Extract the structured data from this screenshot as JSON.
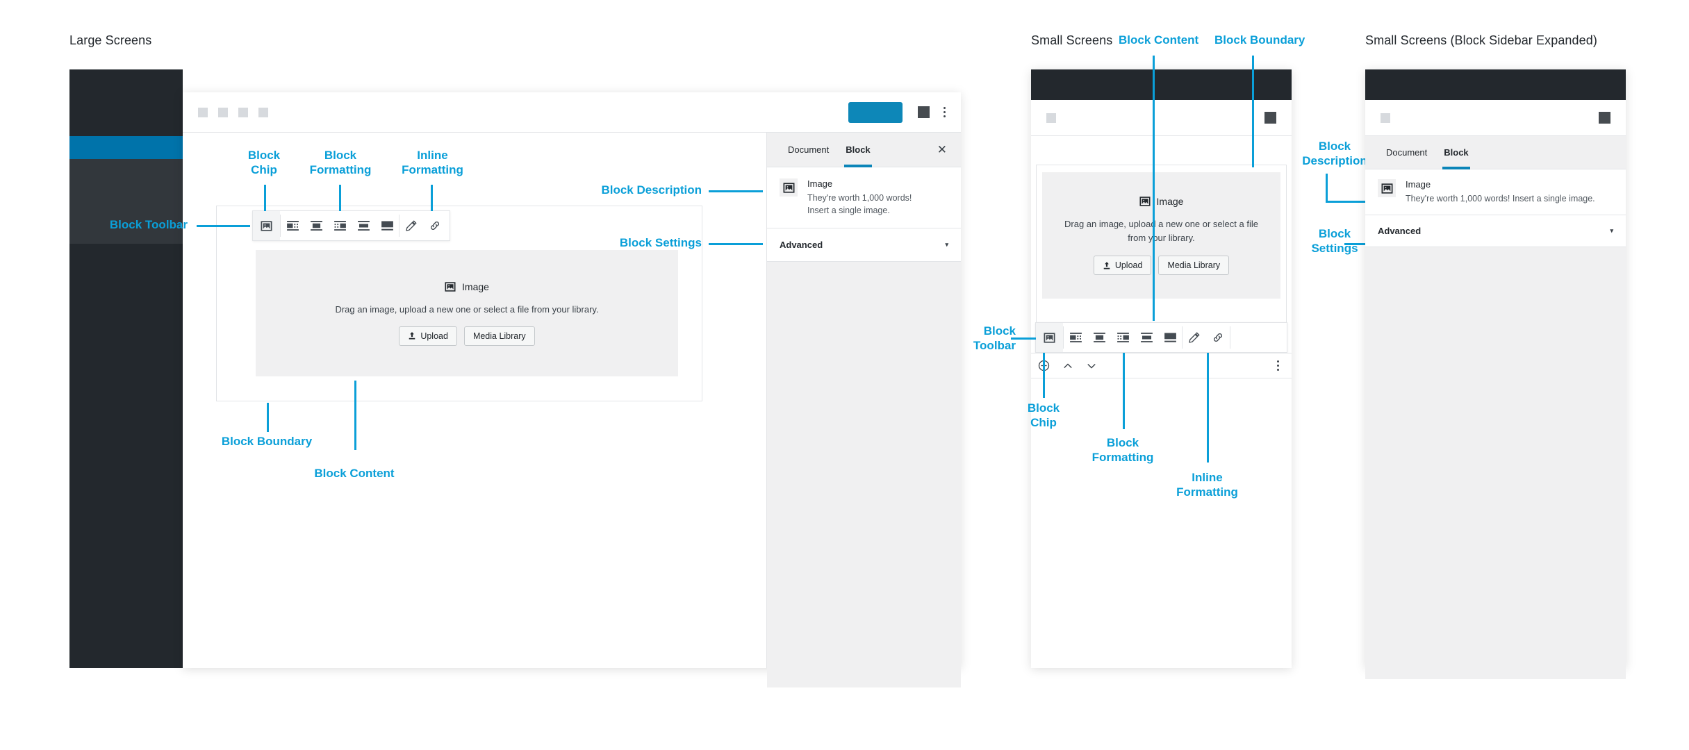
{
  "sections": {
    "large": "Large Screens",
    "small": "Small Screens",
    "small_expanded": "Small Screens (Block Sidebar Expanded)"
  },
  "annotations": {
    "block_toolbar": "Block\nToolbar",
    "block_toolbar_inline": "Block Toolbar",
    "block_chip": "Block\nChip",
    "block_formatting": "Block\nFormatting",
    "inline_formatting": "Inline\nFormatting",
    "block_description": "Block Description",
    "block_description_stacked": "Block\nDescription",
    "block_settings": "Block Settings",
    "block_settings_stacked": "Block\nSettings",
    "block_boundary": "Block Boundary",
    "block_content": "Block Content"
  },
  "placeholder": {
    "title": "Image",
    "description_one_line": "Drag an image, upload a new one or select a file from your library.",
    "description_line1": "Drag an image, upload a new one or select a file",
    "description_line2": "from your library.",
    "upload_label": "Upload",
    "media_library_label": "Media Library"
  },
  "sidebar": {
    "tab_document": "Document",
    "tab_block": "Block",
    "close_glyph": "✕",
    "block_name": "Image",
    "block_desc_line1": "They're worth 1,000 words!",
    "block_desc_line2": "Insert a single image.",
    "block_desc_one_line": "They're worth 1,000 words! Insert a single image.",
    "advanced_label": "Advanced",
    "caret_glyph": "▾"
  },
  "toolbar_icons": [
    "image-block-chip-icon",
    "align-left-icon",
    "align-center-icon",
    "align-right-icon",
    "align-wide-icon",
    "align-full-icon",
    "edit-pencil-icon",
    "link-icon"
  ],
  "mobile_bar_icons": [
    "add-block-icon",
    "move-up-icon",
    "move-down-icon",
    "more-options-icon"
  ],
  "colors": {
    "accent_blue": "#0a9fd8",
    "wp_blue": "#0073aa",
    "wp_dark": "#23282d",
    "wp_grey_dark": "#32373c",
    "placeholder_bg": "#f0f0f1",
    "border": "#e2e4e7",
    "text_dark": "#23282d"
  }
}
